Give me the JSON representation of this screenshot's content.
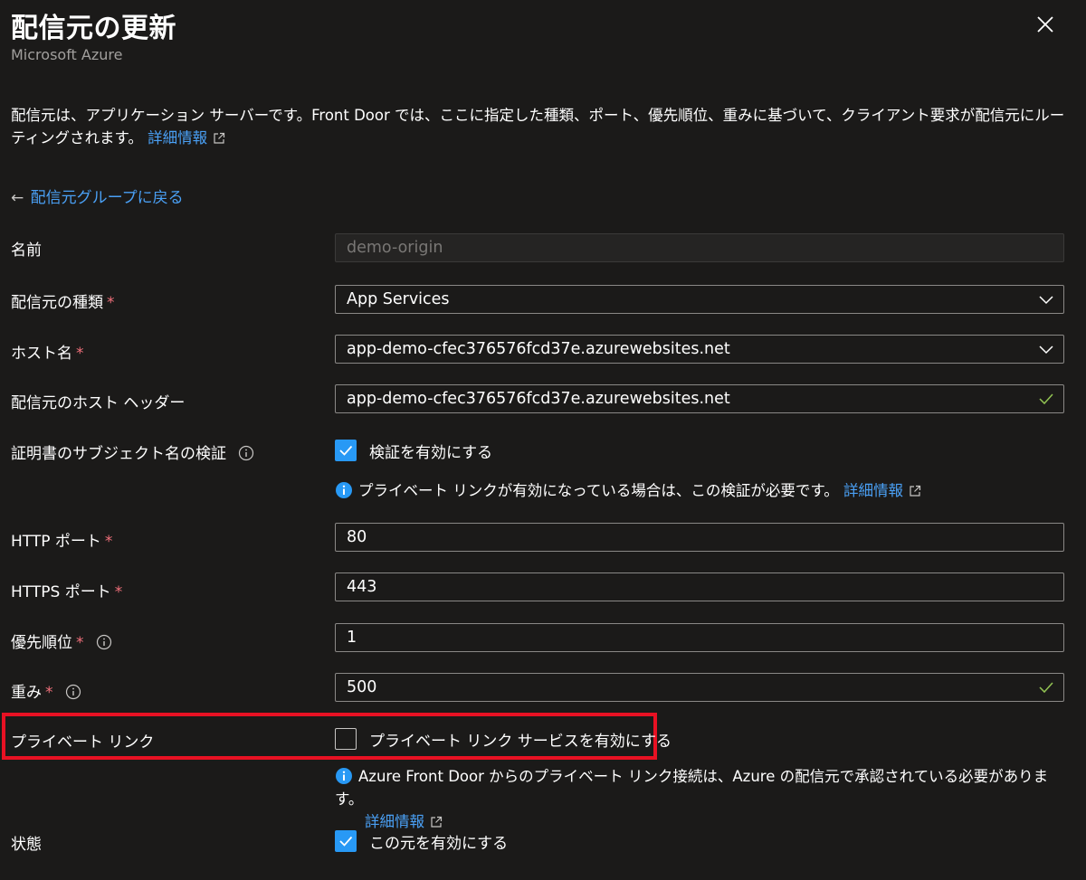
{
  "header": {
    "title": "配信元の更新",
    "subtitle": "Microsoft Azure"
  },
  "description": {
    "text": "配信元は、アプリケーション サーバーです。Front Door では、ここに指定した種類、ポート、優先順位、重みに基づいて、クライアント要求が配信元にルーティングされます。",
    "link": "詳細情報"
  },
  "back_link": "配信元グループに戻る",
  "form": {
    "name": {
      "label": "名前",
      "value": "demo-origin"
    },
    "origin_type": {
      "label": "配信元の種類",
      "required": "*",
      "value": "App Services"
    },
    "host_name": {
      "label": "ホスト名",
      "required": "*",
      "value": "app-demo-cfec376576fcd37e.azurewebsites.net"
    },
    "host_header": {
      "label": "配信元のホスト ヘッダー",
      "value": "app-demo-cfec376576fcd37e.azurewebsites.net"
    },
    "cert_check": {
      "label": "証明書のサブジェクト名の検証",
      "checkbox_label": "検証を有効にする",
      "checked": true,
      "note": "プライベート リンクが有効になっている場合は、この検証が必要です。",
      "note_link": "詳細情報"
    },
    "http_port": {
      "label": "HTTP ポート",
      "required": "*",
      "value": "80"
    },
    "https_port": {
      "label": "HTTPS ポート",
      "required": "*",
      "value": "443"
    },
    "priority": {
      "label": "優先順位",
      "required": "*",
      "value": "1"
    },
    "weight": {
      "label": "重み",
      "required": "*",
      "value": "500"
    },
    "private_link": {
      "label": "プライベート リンク",
      "checkbox_label": "プライベート リンク サービスを有効にする",
      "checked": false,
      "note": "Azure Front Door からのプライベート リンク接続は、Azure の配信元で承認されている必要があります。",
      "note_link": "詳細情報"
    },
    "status": {
      "label": "状態",
      "checkbox_label": "この元を有効にする",
      "checked": true
    }
  },
  "colors": {
    "background": "#1b1a19",
    "accent": "#2899f5",
    "link": "#4aa0f5",
    "required": "#f1707b",
    "valid": "#92c353",
    "highlight": "#e81123"
  }
}
